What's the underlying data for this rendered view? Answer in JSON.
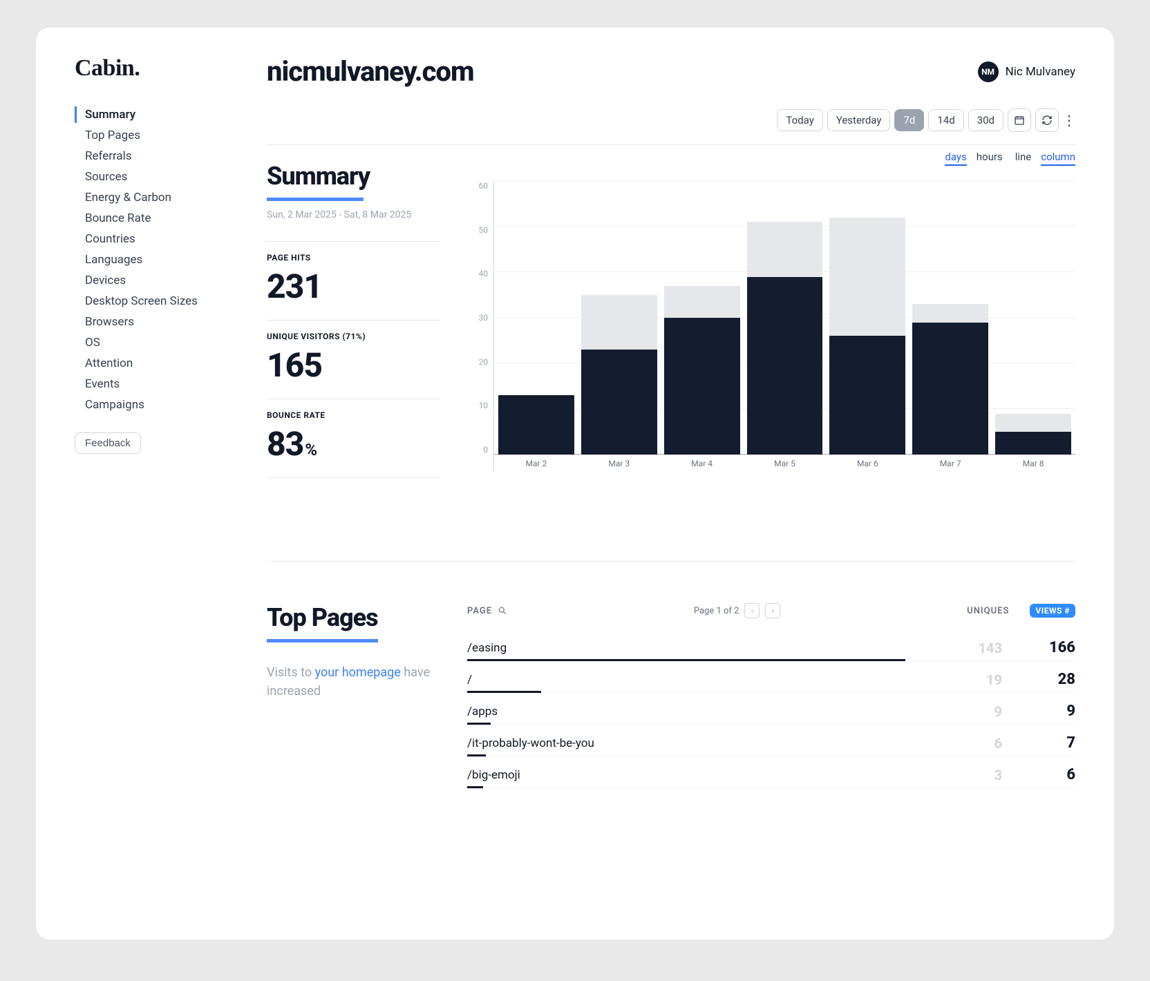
{
  "logo": "Cabin.",
  "nav": {
    "items": [
      "Summary",
      "Top Pages",
      "Referrals",
      "Sources",
      "Energy & Carbon",
      "Bounce Rate",
      "Countries",
      "Languages",
      "Devices",
      "Desktop Screen Sizes",
      "Browsers",
      "OS",
      "Attention",
      "Events",
      "Campaigns"
    ],
    "active_index": 0,
    "feedback_label": "Feedback"
  },
  "header": {
    "site": "nicmulvaney.com",
    "user_initials": "NM",
    "user_name": "Nic Mulvaney"
  },
  "toolbar": {
    "ranges": [
      "Today",
      "Yesterday",
      "7d",
      "14d",
      "30d"
    ],
    "active_range_index": 2
  },
  "summary": {
    "title": "Summary",
    "date_range": "Sun, 2 Mar 2025 - Sat, 8 Mar 2025",
    "metrics": {
      "page_hits_label": "PAGE HITS",
      "page_hits_value": "231",
      "unique_visitors_label": "UNIQUE VISITORS (71%)",
      "unique_visitors_value": "165",
      "bounce_rate_label": "BOUNCE RATE",
      "bounce_rate_value": "83",
      "bounce_rate_suffix": "%"
    },
    "chart_controls": {
      "granularity": [
        "days",
        "hours"
      ],
      "granularity_active": 0,
      "style": [
        "line",
        "column"
      ],
      "style_active": 1
    }
  },
  "chart_data": {
    "type": "bar",
    "title": "Page hits and unique visitors by day",
    "xlabel": "",
    "ylabel": "",
    "ylim": [
      0,
      60
    ],
    "yticks": [
      0,
      10,
      20,
      30,
      40,
      50,
      60
    ],
    "categories": [
      "Mar 2",
      "Mar 3",
      "Mar 4",
      "Mar 5",
      "Mar 6",
      "Mar 7",
      "Mar 8"
    ],
    "series": [
      {
        "name": "Page hits",
        "values": [
          13,
          35,
          37,
          51,
          52,
          33,
          9
        ]
      },
      {
        "name": "Unique visitors",
        "values": [
          13,
          23,
          30,
          39,
          26,
          29,
          5
        ]
      }
    ]
  },
  "top_pages": {
    "title": "Top Pages",
    "note_pre": "Visits to ",
    "note_link": "your homepage",
    "note_post": " have increased",
    "header": {
      "page_label": "PAGE",
      "pager_text": "Page 1 of 2",
      "uniques_label": "UNIQUES",
      "views_label": "VIEWS #"
    },
    "max_views": 166,
    "rows": [
      {
        "path": "/easing",
        "uniques": "143",
        "views": "166"
      },
      {
        "path": "/",
        "uniques": "19",
        "views": "28"
      },
      {
        "path": "/apps",
        "uniques": "9",
        "views": "9"
      },
      {
        "path": "/it-probably-wont-be-you",
        "uniques": "6",
        "views": "7"
      },
      {
        "path": "/big-emoji",
        "uniques": "3",
        "views": "6"
      }
    ]
  }
}
